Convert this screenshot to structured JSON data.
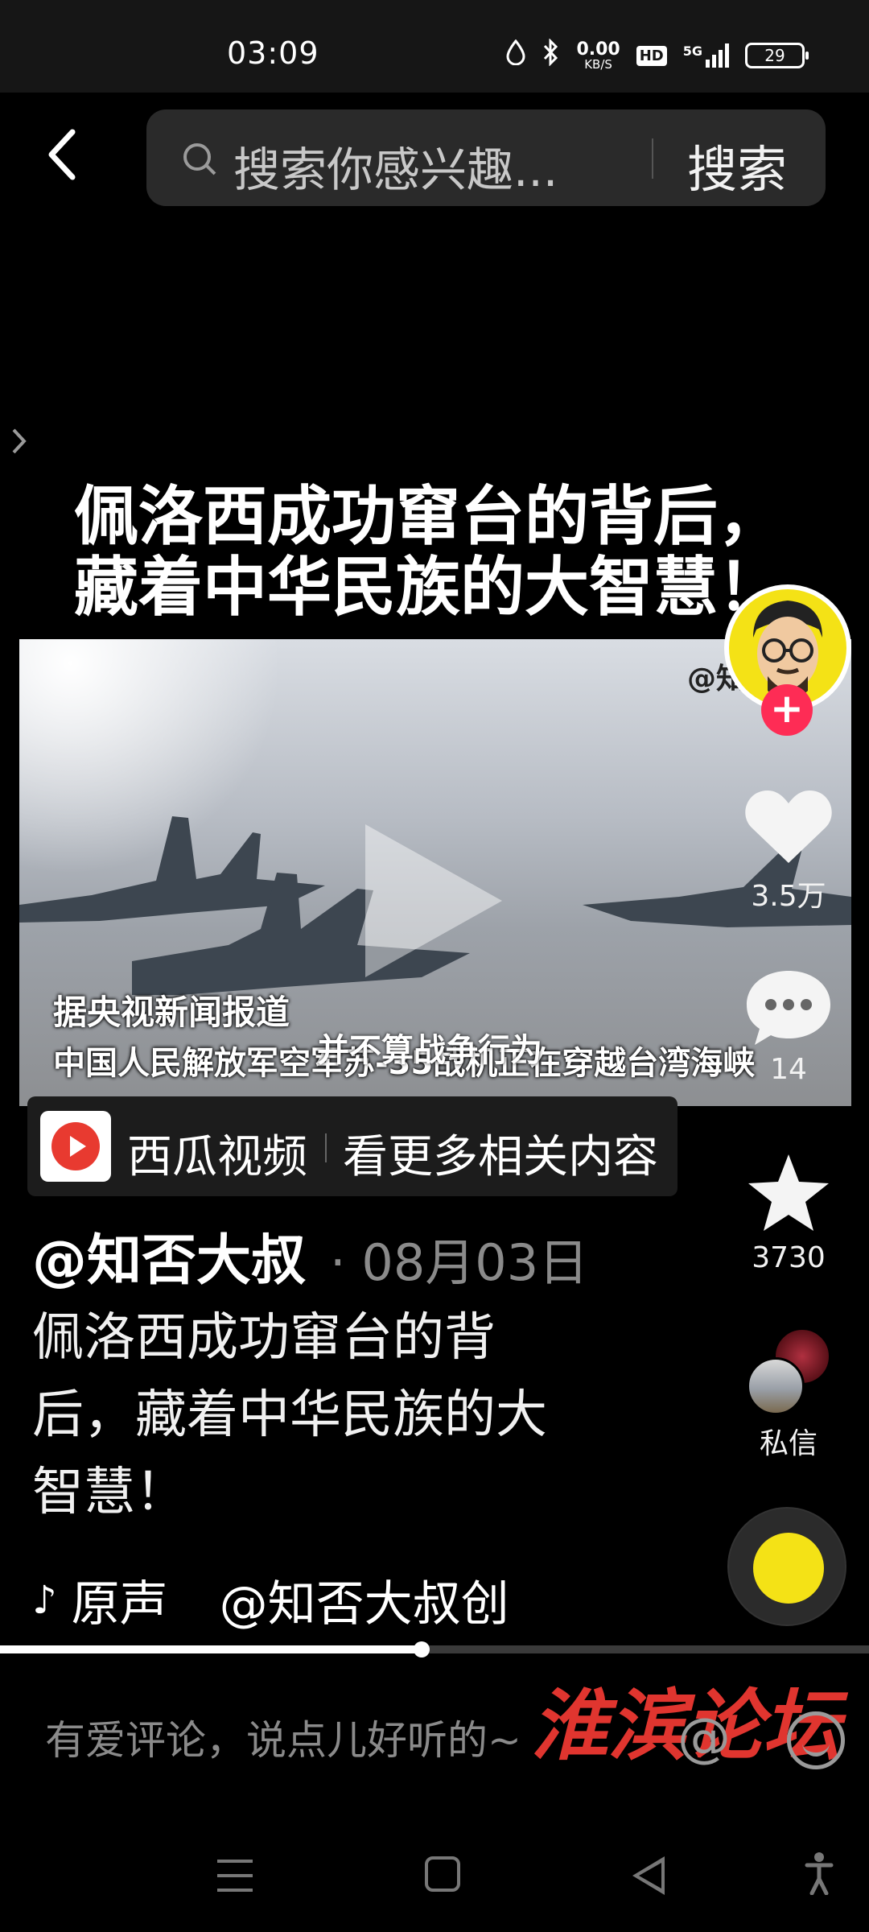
{
  "status_bar": {
    "time": "03:09",
    "net_speed_value": "0.00",
    "net_speed_unit": "KB/S",
    "hd": "HD",
    "network": "5G",
    "battery": "29"
  },
  "header": {
    "search_placeholder": "搜索你感兴趣...",
    "search_button": "搜索"
  },
  "video": {
    "title_line1": "佩洛西成功窜台的背后，",
    "title_line2": "藏着中华民族的大智慧！",
    "handle_overlay": "@知",
    "caption_line1": "据央视新闻报道",
    "caption_line2": "中国人民解放军空军苏-35战机正在穿越台湾海峡",
    "caption_overlay": "并不算战争行为"
  },
  "actions": {
    "like_count": "3.5万",
    "comment_count": "14",
    "favorite_count": "3730",
    "dm_label": "私信"
  },
  "xigua": {
    "name": "西瓜视频",
    "more": "看更多相关内容"
  },
  "post": {
    "author": "@知否大叔",
    "date": "· 08月03日",
    "description": "佩洛西成功窜台的背后，藏着中华民族的大智慧！"
  },
  "music": {
    "label": "原声",
    "creator": "@知否大叔创"
  },
  "progress": {
    "fraction": 0.485
  },
  "comment_bar": {
    "placeholder": "有爱评论，说点儿好听的~",
    "watermark": "淮滨论坛"
  },
  "colors": {
    "accent": "#fe2c55",
    "avatar_yellow": "#f4e216"
  }
}
